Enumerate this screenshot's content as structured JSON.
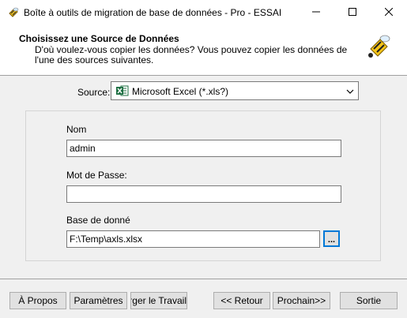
{
  "window": {
    "title": "Boîte à outils de migration de base de données - Pro - ESSAI",
    "icons": {
      "app": "bee-app-icon",
      "minimize": "minimize-icon",
      "maximize": "maximize-icon",
      "close": "close-icon"
    }
  },
  "header": {
    "title": "Choisissez une Source de Données",
    "description": "D'où voulez-vous copier les données? Vous pouvez copier les données de l'une des sources suivantes.",
    "icon": "bee-database-icon"
  },
  "source": {
    "label": "Source:",
    "selected": "Microsoft Excel (*.xls?)",
    "icon": "excel-icon"
  },
  "form": {
    "name_label": "Nom",
    "name_value": "admin",
    "password_label": "Mot de Passe:",
    "password_value": "",
    "database_label": "Base de donné",
    "database_value": "F:\\Temp\\axls.xlsx",
    "browse_label": "..."
  },
  "buttons": {
    "about": "À Propos",
    "settings": "Paramètres",
    "load_job": "Charger le Travail",
    "back": "<< Retour",
    "next": "Prochain>>",
    "exit": "Sortie"
  },
  "colors": {
    "focus": "#0078d7",
    "excel_green": "#1d6f42",
    "bee_yellow": "#f5c518"
  }
}
